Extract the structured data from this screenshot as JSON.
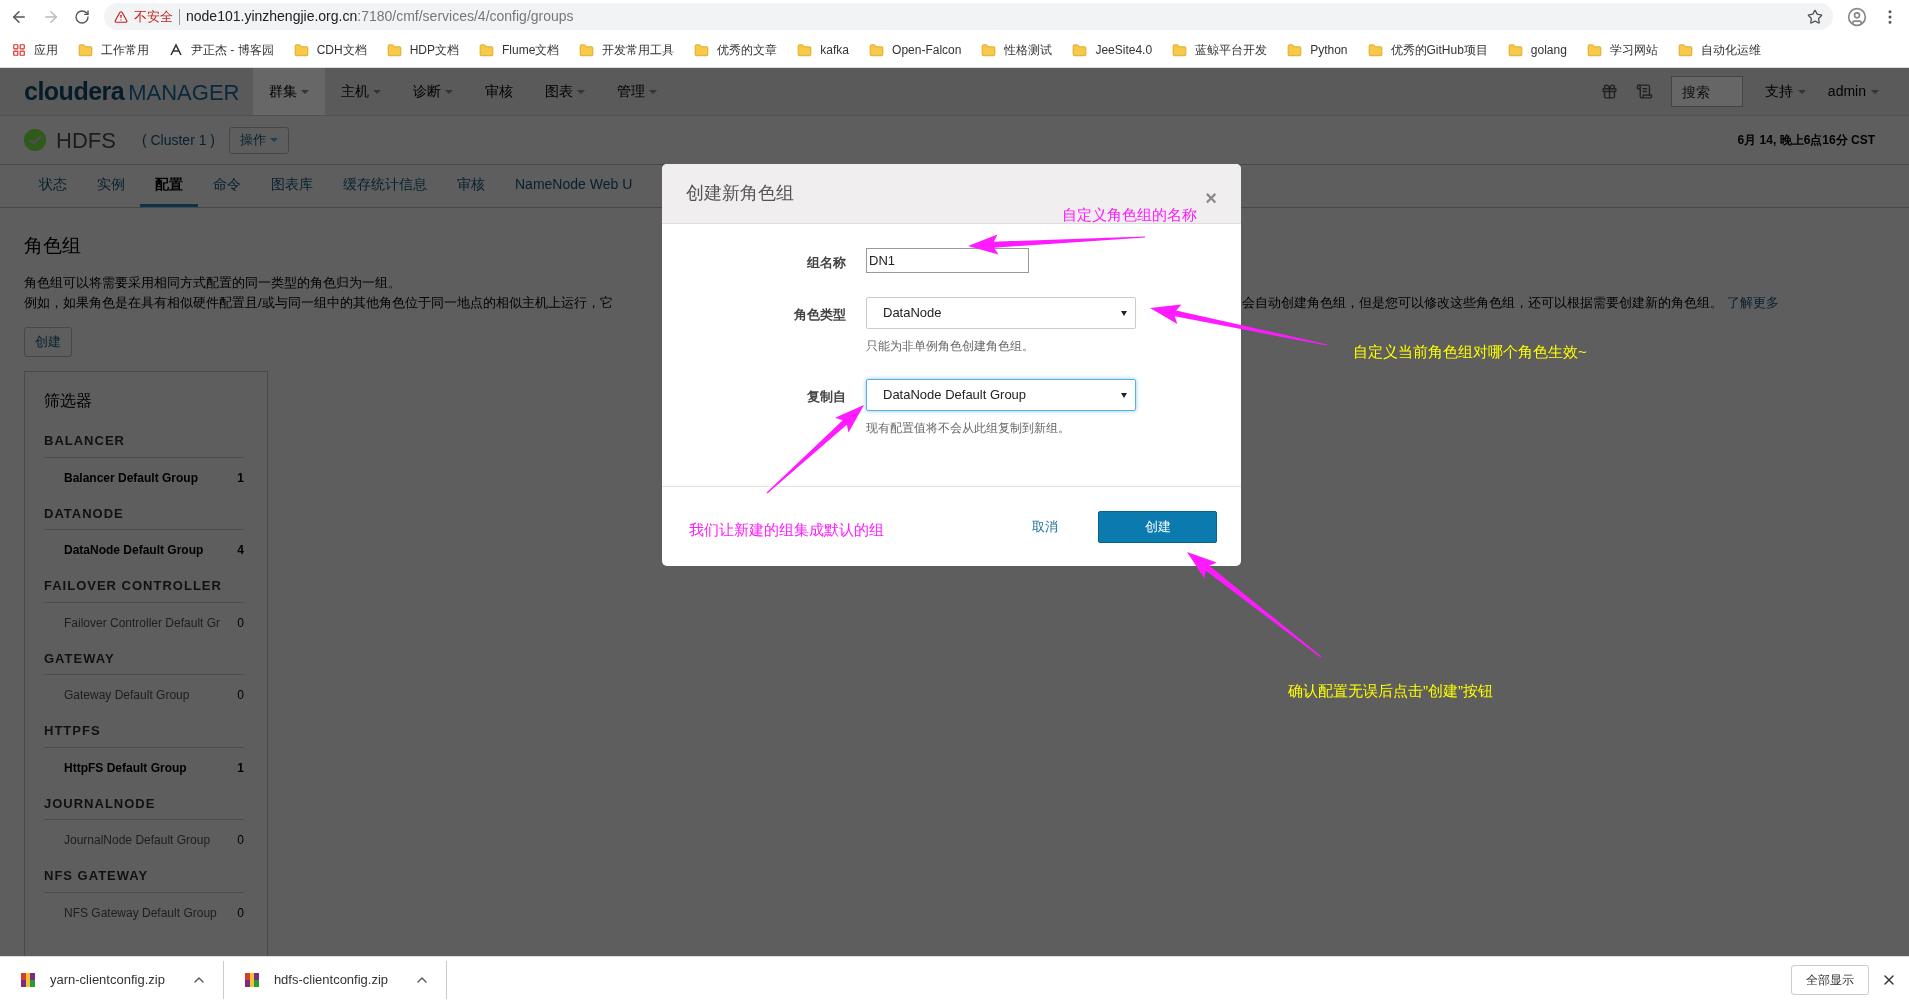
{
  "browser": {
    "security_label": "不安全",
    "url_host": "node101.yinzhengjie.org.cn",
    "url_path": ":7180/cmf/services/4/config/groups"
  },
  "bookmarks": [
    {
      "label": "应用",
      "kind": "apps"
    },
    {
      "label": "工作常用",
      "kind": "folder"
    },
    {
      "label": "尹正杰 - 博客园",
      "kind": "site"
    },
    {
      "label": "CDH文档",
      "kind": "folder"
    },
    {
      "label": "HDP文档",
      "kind": "folder"
    },
    {
      "label": "Flume文档",
      "kind": "folder"
    },
    {
      "label": "开发常用工具",
      "kind": "folder"
    },
    {
      "label": "优秀的文章",
      "kind": "folder"
    },
    {
      "label": "kafka",
      "kind": "folder"
    },
    {
      "label": "Open-Falcon",
      "kind": "folder"
    },
    {
      "label": "性格测试",
      "kind": "folder"
    },
    {
      "label": "JeeSite4.0",
      "kind": "folder"
    },
    {
      "label": "蓝鲸平台开发",
      "kind": "folder"
    },
    {
      "label": "Python",
      "kind": "folder"
    },
    {
      "label": "优秀的GitHub项目",
      "kind": "folder"
    },
    {
      "label": "golang",
      "kind": "folder"
    },
    {
      "label": "学习网站",
      "kind": "folder"
    },
    {
      "label": "自动化运维",
      "kind": "folder"
    }
  ],
  "header": {
    "logo_word": "cloudera",
    "logo_product": "MANAGER",
    "menus": [
      {
        "label": "群集",
        "dropdown": true,
        "selected": true
      },
      {
        "label": "主机",
        "dropdown": true,
        "selected": false
      },
      {
        "label": "诊断",
        "dropdown": true,
        "selected": false
      },
      {
        "label": "审核",
        "dropdown": false,
        "selected": false
      },
      {
        "label": "图表",
        "dropdown": true,
        "selected": false
      },
      {
        "label": "管理",
        "dropdown": true,
        "selected": false
      }
    ],
    "search": {
      "placeholder": "搜索"
    },
    "right_menus": [
      "支持",
      "admin"
    ]
  },
  "service": {
    "name": "HDFS",
    "cluster": "( Cluster 1 )",
    "actions_button": "操作",
    "timestamp": "6月 14, 晚上6点16分 CST"
  },
  "tabs": [
    {
      "label": "状态",
      "selected": false
    },
    {
      "label": "实例",
      "selected": false
    },
    {
      "label": "配置",
      "selected": true
    },
    {
      "label": "命令",
      "selected": false
    },
    {
      "label": "图表库",
      "selected": false
    },
    {
      "label": "缓存统计信息",
      "selected": false
    },
    {
      "label": "审核",
      "selected": false
    },
    {
      "label": "NameNode Web U",
      "selected": false
    }
  ],
  "content": {
    "title": "角色组",
    "description_line_1": "角色组可以将需要采用相同方式配置的同一类型的角色归为一组。",
    "description_line_2_left": "例如，如果角色是在具有相似硬件配置且/或与同一组中的其他角色位于同一地点的相似主机上运行，它",
    "description_line_2_right": "会自动创建角色组，但是您可以修改这些角色组，还可以根据需要创建新的角色组。",
    "learn_more_link": "了解更多",
    "create_button": "创建"
  },
  "filter": {
    "title": "筛选器",
    "groups": [
      {
        "heading": "BALANCER",
        "items": [
          {
            "label": "Balancer Default Group",
            "count": "1",
            "disabled": false
          }
        ]
      },
      {
        "heading": "DATANODE",
        "items": [
          {
            "label": "DataNode Default Group",
            "count": "4",
            "disabled": false
          }
        ]
      },
      {
        "heading": "FAILOVER CONTROLLER",
        "items": [
          {
            "label": "Failover Controller Default Gr",
            "count": "0",
            "disabled": true
          }
        ]
      },
      {
        "heading": "GATEWAY",
        "items": [
          {
            "label": "Gateway Default Group",
            "count": "0",
            "disabled": true
          }
        ]
      },
      {
        "heading": "HTTPFS",
        "items": [
          {
            "label": "HttpFS Default Group",
            "count": "1",
            "disabled": false
          }
        ]
      },
      {
        "heading": "JOURNALNODE",
        "items": [
          {
            "label": "JournalNode Default Group",
            "count": "0",
            "disabled": true
          }
        ]
      },
      {
        "heading": "NFS GATEWAY",
        "items": [
          {
            "label": "NFS Gateway Default Group",
            "count": "0",
            "disabled": true
          }
        ]
      }
    ]
  },
  "dialog": {
    "title": "创建新角色组",
    "close": "×",
    "fields": [
      {
        "kind": "input",
        "label": "组名称",
        "value": "DN1",
        "focused": false
      },
      {
        "kind": "select",
        "label": "角色类型",
        "value": "DataNode",
        "help": "只能为非单例角色创建角色组。",
        "focused": false
      },
      {
        "kind": "select",
        "label": "复制自",
        "value": "DataNode Default Group",
        "help": "现有配置值将不会从此组复制到新组。",
        "focused": true
      }
    ],
    "cancel_link": "取消",
    "create_button": "创建"
  },
  "annotations": [
    {
      "text": "自定义角色组的名称",
      "color": "#ff1aff"
    },
    {
      "text": "自定义当前角色组对哪个角色生效~",
      "color": "#ffff00"
    },
    {
      "text": "我们让新建的组集成默认的组",
      "color": "#ff1aff"
    },
    {
      "text": "确认配置无误后点击”创建”按钮",
      "color": "#ffff00"
    }
  ],
  "downloads": {
    "files": [
      "yarn-clientconfig.zip",
      "hdfs-clientconfig.zip"
    ],
    "show_all_button": "全部显示"
  }
}
